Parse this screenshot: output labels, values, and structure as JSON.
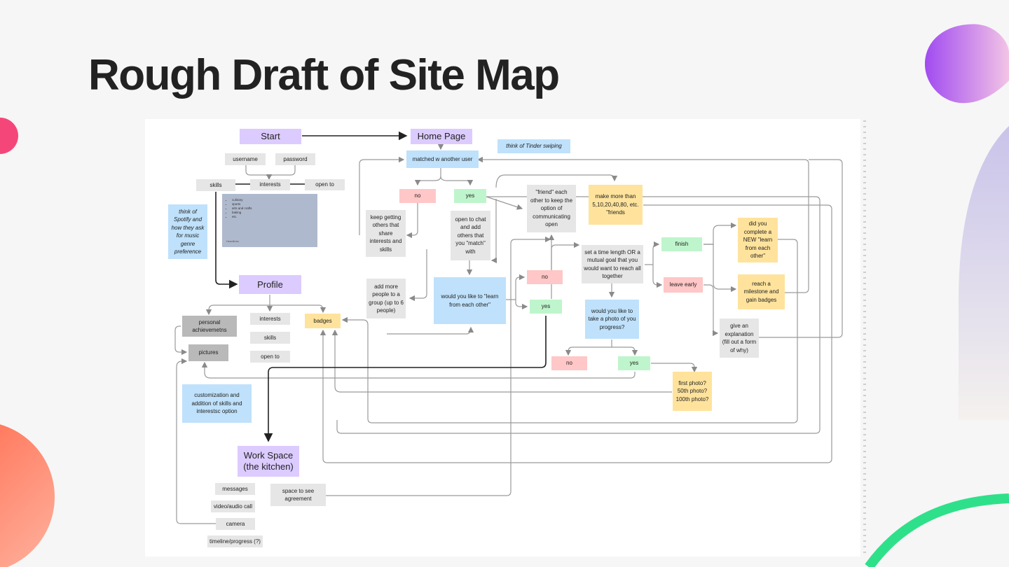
{
  "title": "Rough Draft of Site Map",
  "colors": {
    "lilac": "#dccbff",
    "grey": "#e6e6e6",
    "blue": "#bfe1fb",
    "green": "#bff5cc",
    "red": "#ffc7c7",
    "yellow": "#ffe39c",
    "line": "#9a9a9a"
  },
  "nodes": {
    "start": "Start",
    "home_page": "Home Page",
    "tinder_note": "think of Tinder swiping",
    "matched": "matched w another user",
    "username": "username",
    "password": "password",
    "skills": "skills",
    "interests": "interests",
    "open_to": "open to",
    "panel_items": [
      "culinary",
      "sports",
      "arts and crafts",
      "baking",
      "etc."
    ],
    "panel_caption": "Headlines",
    "spotify_note": "think of Spotify and how they ask for music genre preference",
    "no_1": "no",
    "yes_1": "yes",
    "keep_getting": "keep getting others that share interests and skills",
    "open_to_chat": "open to chat and add others that you \"match\" with",
    "friend_each": "\"friend\" each other to keep the option of communicating open",
    "make_more": "make more than 5,10,20,40,80, etc. \"friends",
    "add_more": "add more people to a group (up to 6 people)",
    "would_learn": "would you like to \"learn from each other\"",
    "no_2": "no",
    "yes_2": "yes",
    "set_time": "set a time length OR a mutual goal that you would want to reach all together",
    "finish": "finish",
    "leave_early": "leave early",
    "did_you": "did you complete a NEW \"learn from each other\"",
    "reach_milestone": "reach a milestone and gain badges",
    "give_explanation": "give an explanation (fill out a form of why)",
    "photo_q": "would you like to take a photo of you progress?",
    "no_3": "no",
    "yes_3": "yes",
    "first_photo": "first photo? 50th photo? 100th photo?",
    "profile": "Profile",
    "personal": "personal achievemetns",
    "pictures": "pictures",
    "p_interests": "interests",
    "p_skills": "skills",
    "p_open_to": "open to",
    "badges": "badges",
    "customization": "customization and addition of skills and interestsc option",
    "workspace": "Work Space (the kitchen)",
    "messages": "messages",
    "video_call": "video/audio call",
    "camera": "camera",
    "timeline": "timeline/progress (?)",
    "space_agreement": "space to see agreement"
  }
}
